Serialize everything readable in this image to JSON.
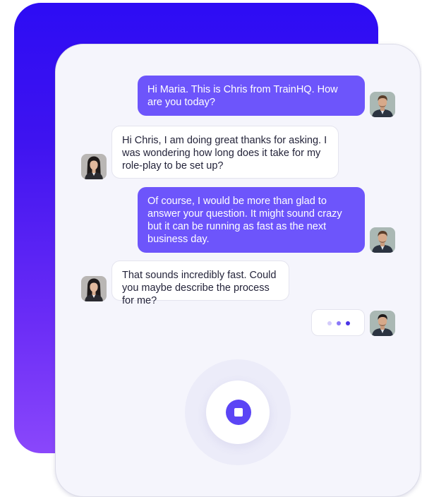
{
  "conversation": {
    "messages": [
      {
        "sender": "Chris",
        "direction": "outgoing",
        "text": "Hi Maria. This is Chris from TrainHQ. How are you today?"
      },
      {
        "sender": "Maria",
        "direction": "incoming",
        "text": "Hi Chris, I am doing great thanks for asking. I was wondering how long does it take for my role-play to be set up?"
      },
      {
        "sender": "Chris",
        "direction": "outgoing",
        "text": "Of course, I would be more than glad to answer your question. It might sound crazy but it can be running as fast as the next business day."
      },
      {
        "sender": "Maria",
        "direction": "incoming",
        "text": "That sounds incredibly fast. Could you maybe describe the process for me?"
      }
    ],
    "typing_indicator": {
      "sender": "Chris",
      "dots": 3
    }
  },
  "avatars": {
    "chris": "man-portrait",
    "maria": "woman-portrait"
  },
  "controls": {
    "stop_icon": "stop-icon"
  },
  "colors": {
    "accent": "#6d55fb",
    "stop_button": "#5b45f5",
    "back_card_top": "#2d0cf4",
    "back_card_bottom": "#8a47fb",
    "card_background": "#f5f5fc",
    "typing_dot_light": "#d4ccfb",
    "typing_dot_mid": "#8a78f8",
    "typing_dot_dark": "#4a33e6"
  }
}
